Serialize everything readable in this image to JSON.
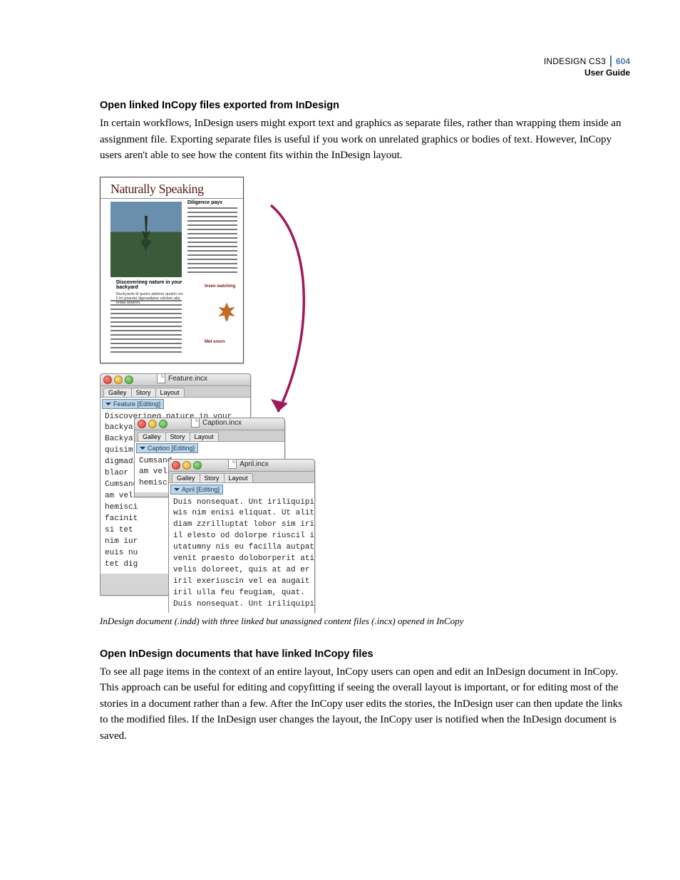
{
  "header": {
    "product": "INDESIGN CS3",
    "page_number": "604",
    "subtitle": "User Guide"
  },
  "section1": {
    "title": "Open linked InCopy files exported from InDesign",
    "body": "In certain workflows, InDesign users might export text and graphics as separate files, rather than wrapping them inside an assignment file. Exporting separate files is useful if you work on unrelated graphics or bodies of text. However, InCopy users aren't able to see how the content fits within the InDesign layout."
  },
  "figure": {
    "caption": "InDesign document (.indd) with three linked but unassigned content files (.incx) opened in InCopy",
    "indesign_layout": {
      "masthead": "Naturally Speaking",
      "subhead": "Diligence pays",
      "caption_title": "Discoverineg nature in your backyard",
      "caption_sub": "Backyards til quees adidore quisim vor il im posrela digmadipiss odoleto alip tetdai blepron.",
      "sidebar1": "Insen watching",
      "sidebar2": "Met snorn"
    },
    "tabs": {
      "t1": "Galley",
      "t2": "Story",
      "t3": "Layout"
    },
    "windows": [
      {
        "filename": "Feature.incx",
        "story_header": "Feature [Editing]",
        "text": "Discoverineg nature in your\nbackyar\nBackyar\nquisim\ndigmadi\nblaor s\nCumsand\nam veli\nhemisci\nfacinit\nsi tet\nnim iur\neuis nu\ntet dig"
      },
      {
        "filename": "Caption.incx",
        "story_header": "Caption [Editing]",
        "text": "Cumsand\nam veli\nhemisci"
      },
      {
        "filename": "April.incx",
        "story_header": "April [Editing]",
        "text": "Duis nonsequat. Unt iriliquipit\nwis nim enisi eliquat. Ut alit\ndiam zzrilluptat lobor sim irit\nil elesto od dolorpe riuscil il\nutatumny nis eu facilla autpat\nvenit praesto doloborperit atin\nvelis doloreet, quis at ad er\niril exeriuscin vel ea augait\niril ulla feu feugiam, quat.\nDuis nonsequat. Unt iriliquipit"
      }
    ]
  },
  "section2": {
    "title": "Open InDesign documents that have linked InCopy files",
    "body": "To see all page items in the context of an entire layout, InCopy users can open and edit an InDesign document in InCopy. This approach can be useful for editing and copyfitting if seeing the overall layout is important, or for editing most of the stories in a document rather than a few. After the InCopy user edits the stories, the InDesign user can then update the links to the modified files. If the InDesign user changes the layout, the InCopy user is notified when the InDesign document is saved."
  }
}
